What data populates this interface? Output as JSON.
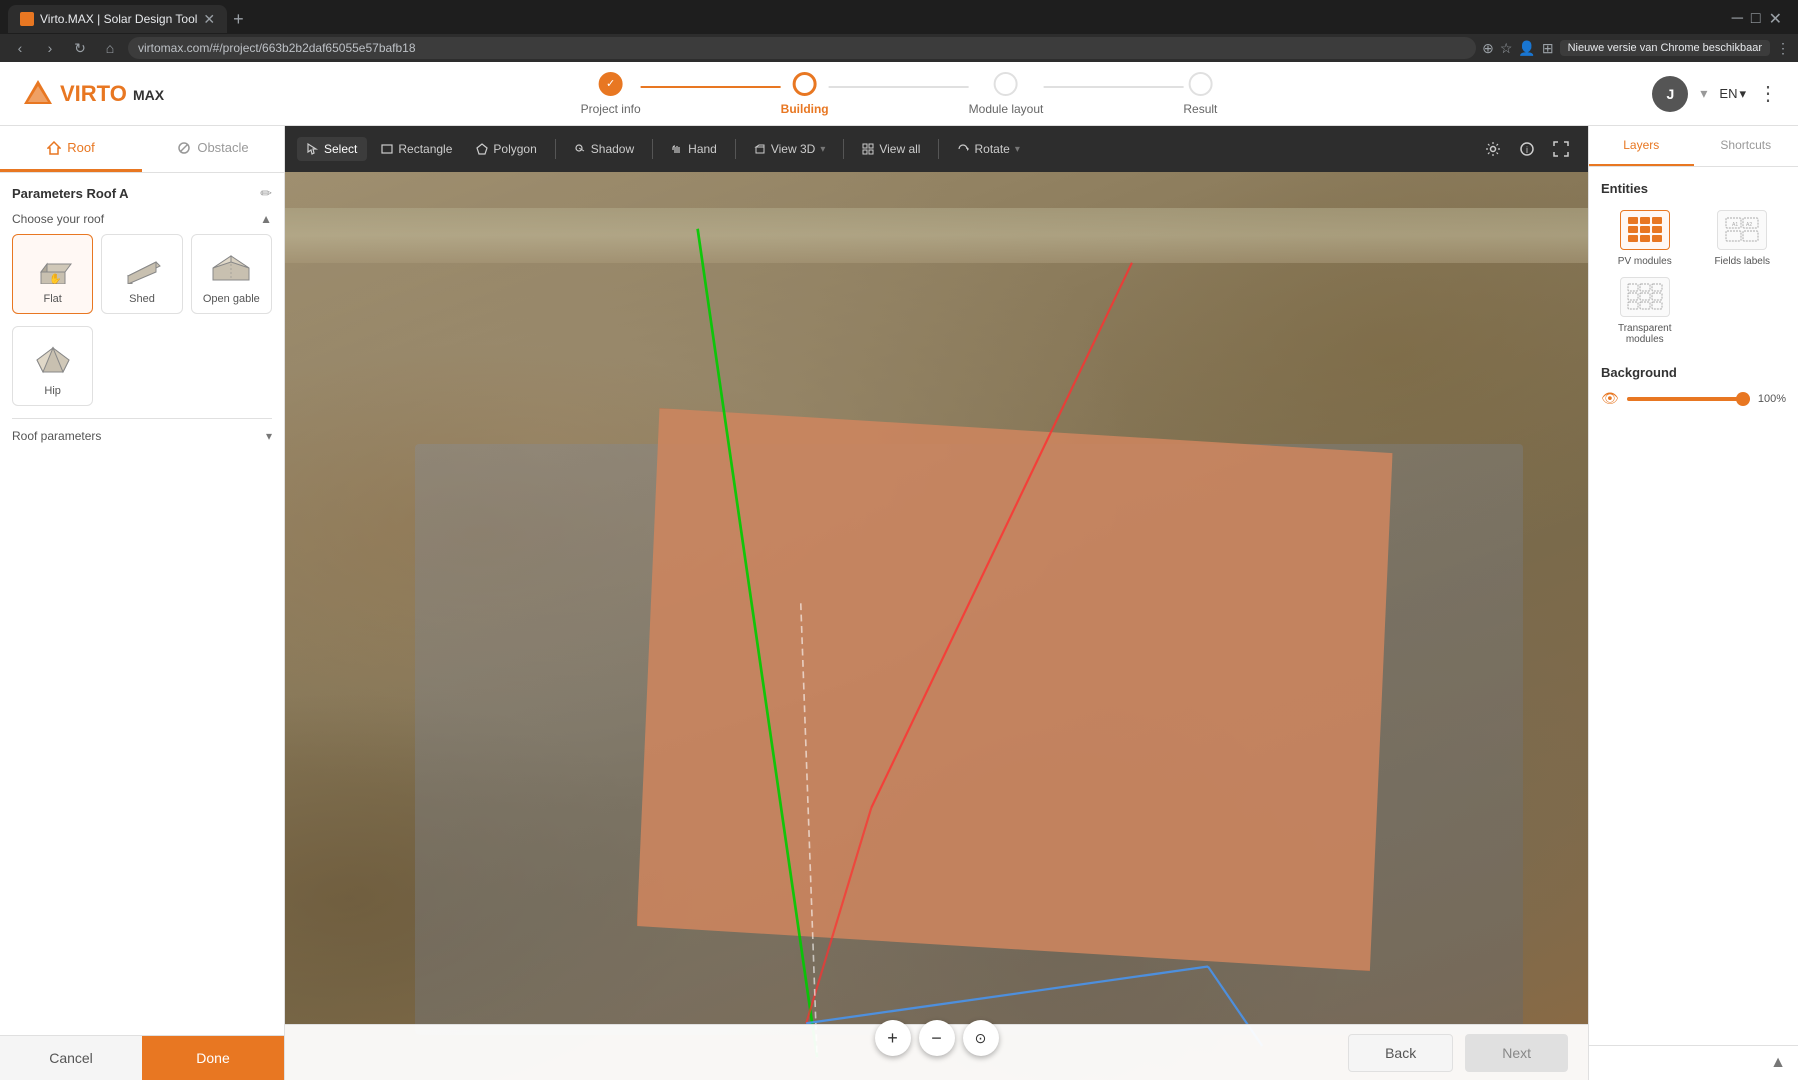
{
  "browser": {
    "tab_title": "Virto.MAX | Solar Design Tool",
    "url": "virtomax.com/#/project/663b2b2daf65055e57bafb18",
    "update_text": "Nieuwe versie van Chrome beschikbaar"
  },
  "header": {
    "logo_text": "VIRTO",
    "logo_max": "MAX",
    "steps": [
      {
        "label": "Project info",
        "state": "done"
      },
      {
        "label": "Building",
        "state": "active"
      },
      {
        "label": "Module layout",
        "state": "inactive"
      },
      {
        "label": "Result",
        "state": "inactive"
      }
    ],
    "lang": "EN",
    "avatar_initial": "J"
  },
  "toolbar": {
    "select_label": "Select",
    "rectangle_label": "Rectangle",
    "polygon_label": "Polygon",
    "shadow_label": "Shadow",
    "hand_label": "Hand",
    "view3d_label": "View 3D",
    "viewall_label": "View all",
    "rotate_label": "Rotate"
  },
  "left_sidebar": {
    "tabs": [
      {
        "label": "Roof",
        "icon": "roof-icon",
        "active": true
      },
      {
        "label": "Obstacle",
        "icon": "obstacle-icon",
        "active": false
      }
    ],
    "section_title": "Parameters Roof A",
    "choose_roof_label": "Choose your roof",
    "roof_types": [
      {
        "label": "Flat",
        "active": true
      },
      {
        "label": "Shed",
        "active": false
      },
      {
        "label": "Open gable",
        "active": false
      }
    ],
    "roof_type_hip": {
      "label": "Hip",
      "active": false
    },
    "roof_params_label": "Roof parameters",
    "cancel_label": "Cancel",
    "done_label": "Done"
  },
  "right_panel": {
    "tabs": [
      {
        "label": "Layers",
        "active": true
      },
      {
        "label": "Shortcuts",
        "active": false
      }
    ],
    "entities_title": "Entities",
    "layer_items": [
      {
        "label": "PV modules",
        "active": true
      },
      {
        "label": "Fields labels",
        "active": false
      },
      {
        "label": "Transparent modules",
        "active": false
      }
    ],
    "background_title": "Background",
    "bg_opacity": "100%"
  },
  "bottom_buttons": {
    "back_label": "Back",
    "next_label": "Next"
  },
  "map_controls": {
    "zoom_in": "+",
    "zoom_out": "−",
    "target": "⊙"
  }
}
